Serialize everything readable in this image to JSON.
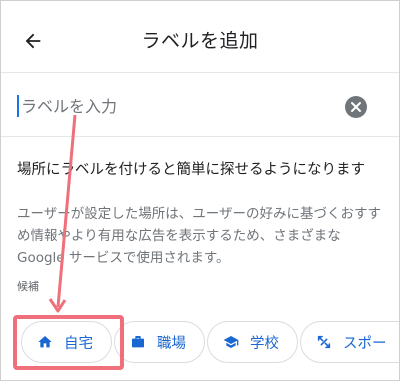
{
  "app_bar": {
    "title": "ラベルを追加",
    "back_icon": "arrow-back-icon"
  },
  "search": {
    "placeholder": "ラベルを入力",
    "clear_icon": "clear-icon"
  },
  "content": {
    "heading": "場所にラベルを付けると簡単に探せるようになります",
    "description": "ユーザーが設定した場所は、ユーザーの好みに基づくおすすめ情報やより有用な広告を表示するため、さまざまな Google サービスで使用されます。",
    "candidates_label": "候補"
  },
  "chips": [
    {
      "label": "自宅",
      "icon": "home-icon"
    },
    {
      "label": "職場",
      "icon": "briefcase-icon"
    },
    {
      "label": "学校",
      "icon": "school-icon"
    },
    {
      "label": "スポー",
      "icon": "fitness-icon"
    }
  ],
  "colors": {
    "accent": "#1967d2",
    "annotation": "#ef6f7a",
    "muted_text": "#70757a"
  }
}
